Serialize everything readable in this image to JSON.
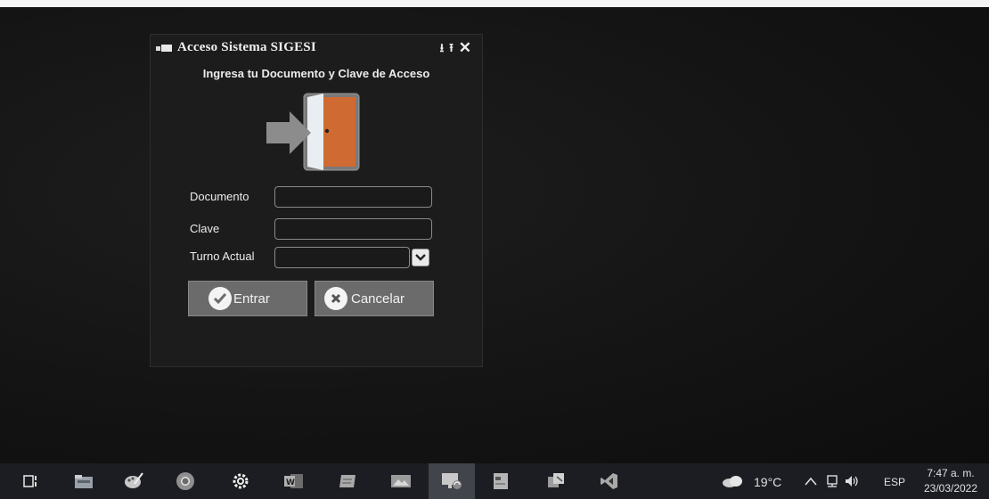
{
  "dialog": {
    "title": "Acceso Sistema SIGESI",
    "subtitle": "Ingresa tu Documento y Clave de Acceso",
    "controls": {
      "minimize": "⭳",
      "restore": "⭱",
      "close": "✕"
    },
    "fields": {
      "documento": {
        "label": "Documento",
        "value": ""
      },
      "clave": {
        "label": "Clave",
        "value": ""
      },
      "turno": {
        "label": "Turno Actual",
        "value": ""
      }
    },
    "buttons": {
      "entrar": "Entrar",
      "cancelar": "Cancelar"
    }
  },
  "taskbar": {
    "icons": [
      "task-view-icon",
      "file-explorer-icon",
      "paint-icon",
      "chrome-icon",
      "settings-gear-icon",
      "word-icon",
      "notepad-icon",
      "image-viewer-icon",
      "remote-desktop-icon",
      "document-editor-icon",
      "snipping-tool-icon",
      "visual-studio-icon"
    ],
    "active_icon": "remote-desktop-icon",
    "tray": {
      "temperature": "19°C",
      "language": "ESP",
      "time": "7:47 a. m.",
      "date": "23/03/2022"
    }
  },
  "colors": {
    "button_bg": "#6b6b6b",
    "dialog_bg": "#1c1c1c",
    "door_orange": "#cf6a33",
    "arrow_gray": "#8c8c8c"
  }
}
